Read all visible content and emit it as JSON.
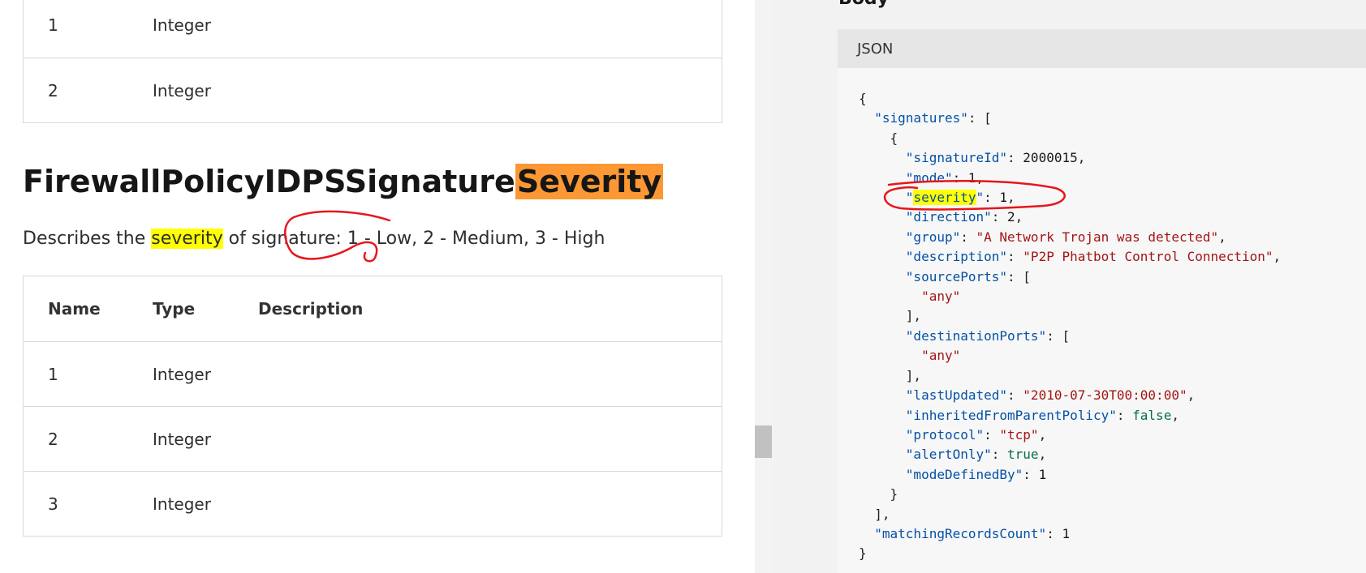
{
  "top_table": {
    "rows": [
      {
        "name": "1",
        "type": "Integer"
      },
      {
        "name": "2",
        "type": "Integer"
      }
    ]
  },
  "heading": {
    "prefix": "FirewallPolicyIDPSSignature",
    "highlight": "Severity"
  },
  "description": {
    "before": "Describes the ",
    "highlight": "severity",
    "after": " of signature: 1 - Low, 2 - Medium, 3 - High"
  },
  "values_table": {
    "headers": [
      "Name",
      "Type",
      "Description"
    ],
    "rows": [
      {
        "name": "1",
        "type": "Integer",
        "description": ""
      },
      {
        "name": "2",
        "type": "Integer",
        "description": ""
      },
      {
        "name": "3",
        "type": "Integer",
        "description": ""
      }
    ]
  },
  "body_section": {
    "title": "Body",
    "code_language": "JSON"
  },
  "code": {
    "open_brace": "{",
    "signatures_key": "\"signatures\"",
    "signatures_open": ": [",
    "obj_open": "{",
    "signatureId_key": "\"signatureId\"",
    "signatureId_val": "2000015",
    "mode_key": "\"mode\"",
    "mode_val": "1",
    "severity_quote": "\"",
    "severity_word": "severity",
    "severity_val": "1",
    "direction_key": "\"direction\"",
    "direction_val": "2",
    "group_key": "\"group\"",
    "group_val": "\"A Network Trojan was detected\"",
    "description_key": "\"description\"",
    "description_val": "\"P2P Phatbot Control Connection\"",
    "sourcePorts_key": "\"sourcePorts\"",
    "sourcePorts_item": "\"any\"",
    "destinationPorts_key": "\"destinationPorts\"",
    "destinationPorts_item": "\"any\"",
    "lastUpdated_key": "\"lastUpdated\"",
    "lastUpdated_val": "\"2010-07-30T00:00:00\"",
    "inherited_key": "\"inheritedFromParentPolicy\"",
    "inherited_val": "false",
    "protocol_key": "\"protocol\"",
    "protocol_val": "\"tcp\"",
    "alertOnly_key": "\"alertOnly\"",
    "alertOnly_val": "true",
    "modeDefinedBy_key": "\"modeDefinedBy\"",
    "modeDefinedBy_val": "1",
    "obj_close": "}",
    "array_close": "],",
    "matchingRecordsCount_key": "\"matchingRecordsCount\"",
    "matchingRecordsCount_val": "1",
    "close_brace": "}"
  },
  "colors": {
    "heading_highlight": "#fb9833",
    "text_highlight": "#ffff00",
    "annotation": "#e8151b",
    "json_key": "#0451a5",
    "json_string": "#a31515",
    "json_bool": "#096d48"
  }
}
